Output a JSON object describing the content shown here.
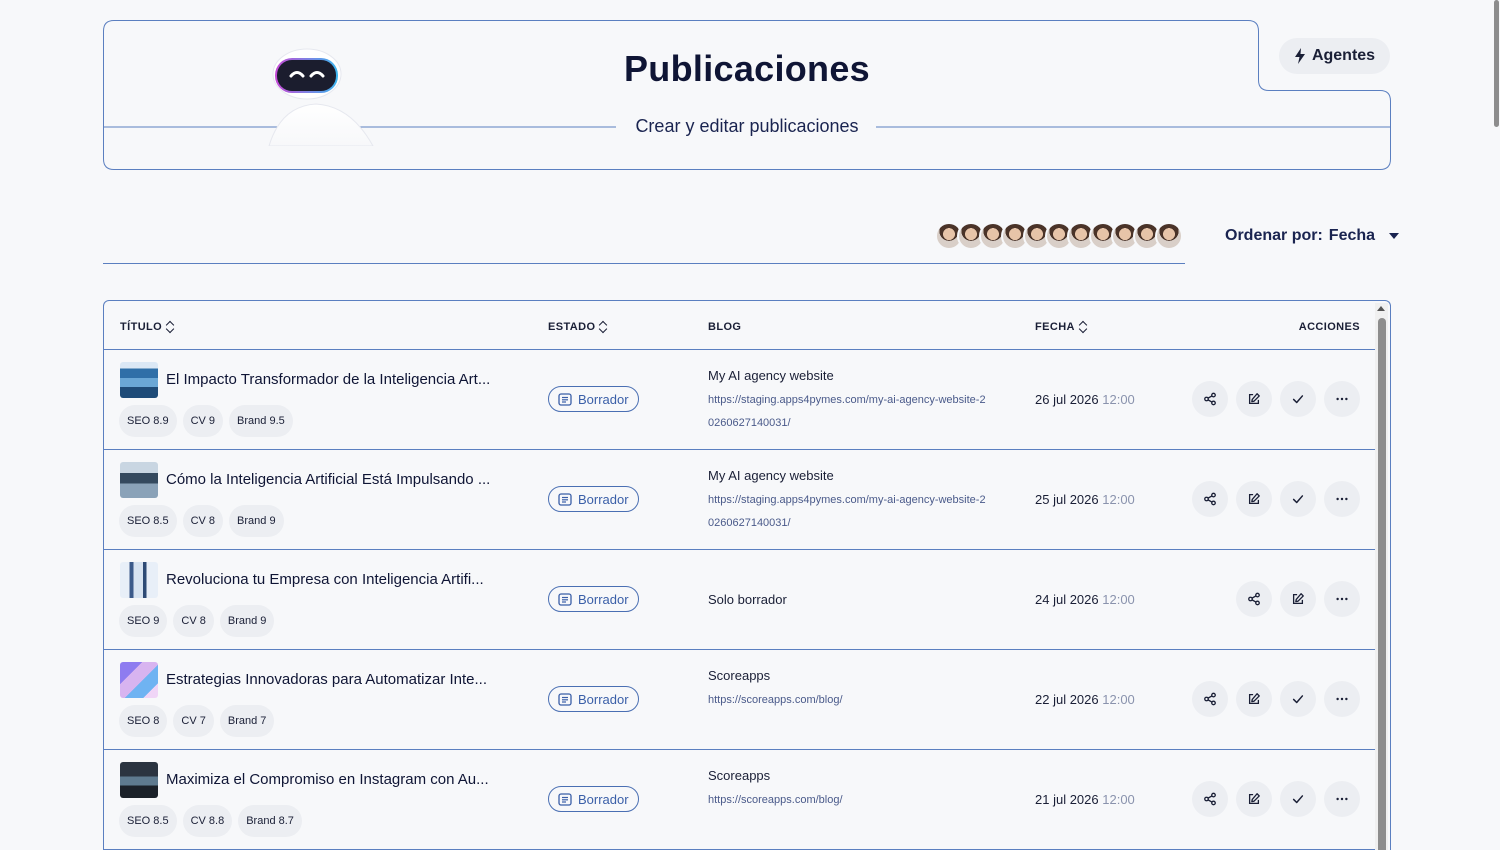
{
  "header": {
    "title": "Publicaciones",
    "subtitle": "Crear y editar publicaciones",
    "agents_label": "Agentes"
  },
  "toolbar": {
    "avatar_count": 11,
    "sort_label": "Ordenar por:",
    "sort_value": "Fecha"
  },
  "table": {
    "columns": {
      "title": "TÍTULO",
      "status": "ESTADO",
      "blog": "BLOG",
      "date": "FECHA",
      "actions": "ACCIONES"
    },
    "rows": [
      {
        "title": "El Impacto Transformador de la Inteligencia Art...",
        "scores": [
          "SEO 8.9",
          "CV 9",
          "Brand 9.5"
        ],
        "status": "Borrador",
        "blog_name": "My AI agency website",
        "blog_url": "https://staging.apps4pymes.com/my-ai-agency-website-20260627140031/",
        "date": "26 jul 2026",
        "time": "12:00",
        "has_publish": true
      },
      {
        "title": "Cómo la Inteligencia Artificial Está Impulsando ...",
        "scores": [
          "SEO 8.5",
          "CV 8",
          "Brand 9"
        ],
        "status": "Borrador",
        "blog_name": "My AI agency website",
        "blog_url": "https://staging.apps4pymes.com/my-ai-agency-website-20260627140031/",
        "date": "25 jul 2026",
        "time": "12:00",
        "has_publish": true
      },
      {
        "title": "Revoluciona tu Empresa con Inteligencia Artifi...",
        "scores": [
          "SEO 9",
          "CV 8",
          "Brand 9"
        ],
        "status": "Borrador",
        "blog_name": "Solo borrador",
        "blog_url": "",
        "date": "24 jul 2026",
        "time": "12:00",
        "has_publish": false
      },
      {
        "title": "Estrategias Innovadoras para Automatizar Inte...",
        "scores": [
          "SEO 8",
          "CV 7",
          "Brand 7"
        ],
        "status": "Borrador",
        "blog_name": "Scoreapps",
        "blog_url": "https://scoreapps.com/blog/",
        "date": "22 jul 2026",
        "time": "12:00",
        "has_publish": true
      },
      {
        "title": "Maximiza el Compromiso en Instagram con Au...",
        "scores": [
          "SEO 8.5",
          "CV 8.8",
          "Brand 8.7"
        ],
        "status": "Borrador",
        "blog_name": "Scoreapps",
        "blog_url": "https://scoreapps.com/blog/",
        "date": "21 jul 2026",
        "time": "12:00",
        "has_publish": true
      }
    ]
  },
  "colors": {
    "accent": "#5b7fc0",
    "status": "#3a5fa8",
    "chip_bg": "#eceef2",
    "text": "#1a1f36"
  },
  "icons": {
    "agents": "bolt-icon",
    "sort": "chevron-down-icon",
    "status": "document-icon",
    "share": "share-icon",
    "edit": "edit-icon",
    "publish": "check-icon",
    "more": "more-icon"
  }
}
